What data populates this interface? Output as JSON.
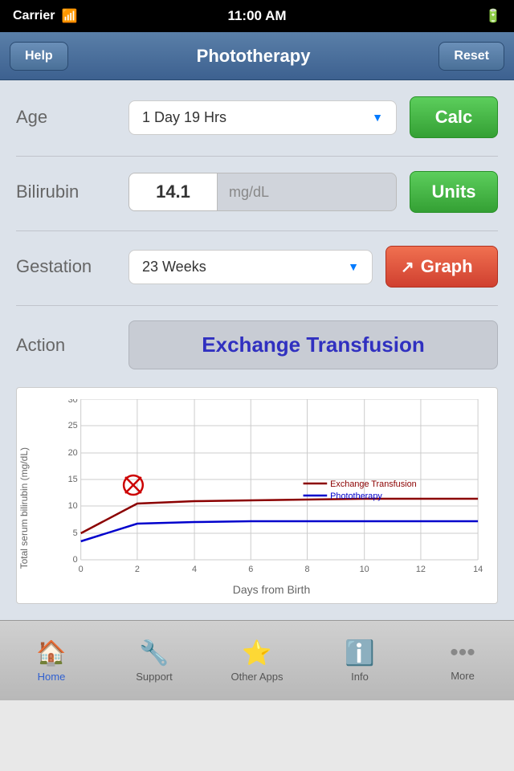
{
  "statusBar": {
    "carrier": "Carrier",
    "time": "11:00 AM",
    "battery": "▓▓▓"
  },
  "navBar": {
    "title": "Phototherapy",
    "helpLabel": "Help",
    "resetLabel": "Reset"
  },
  "fields": {
    "ageLabel": "Age",
    "ageValue": "1 Day 19 Hrs",
    "calcLabel": "Calc",
    "bilirubinLabel": "Bilirubin",
    "bilirubinValue": "14.1",
    "bilirubinUnit": "mg/dL",
    "unitsLabel": "Units",
    "gestationLabel": "Gestation",
    "gestationValue": "23 Weeks",
    "graphLabel": "Graph",
    "actionLabel": "Action",
    "actionValue": "Exchange Transfusion"
  },
  "chart": {
    "yAxisLabel": "Total serum bilirubin (mg/dL)",
    "xAxisLabel": "Days from Birth",
    "yTicks": [
      0,
      5,
      10,
      15,
      20,
      25,
      30
    ],
    "xTicks": [
      0,
      2,
      4,
      6,
      8,
      10,
      12,
      14
    ],
    "exchangeLabel": "Exchange Transfusion",
    "phototherapyLabel": "Phototherapy",
    "dataPointX": 1.9,
    "dataPointY": 14.1
  },
  "tabs": [
    {
      "id": "home",
      "label": "Home",
      "active": true
    },
    {
      "id": "support",
      "label": "Support",
      "active": false
    },
    {
      "id": "other-apps",
      "label": "Other Apps",
      "active": false
    },
    {
      "id": "info",
      "label": "Info",
      "active": false
    },
    {
      "id": "more",
      "label": "More",
      "active": false
    }
  ]
}
